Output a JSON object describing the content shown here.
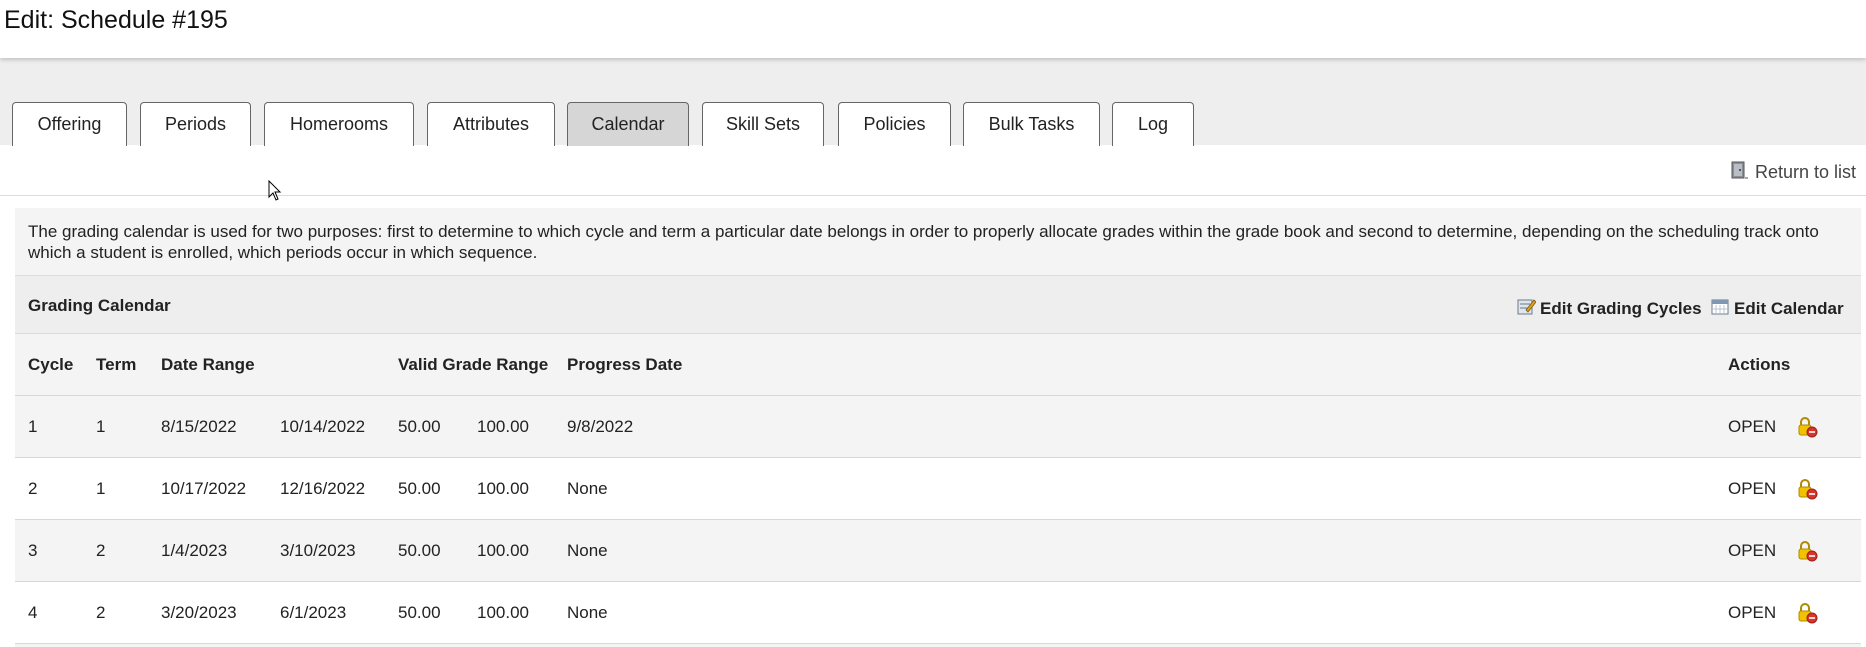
{
  "header": {
    "title": "Edit: Schedule #195"
  },
  "tabs": [
    {
      "label": "Offering",
      "active": false
    },
    {
      "label": "Periods",
      "active": false
    },
    {
      "label": "Homerooms",
      "active": false
    },
    {
      "label": "Attributes",
      "active": false
    },
    {
      "label": "Calendar",
      "active": true
    },
    {
      "label": "Skill Sets",
      "active": false
    },
    {
      "label": "Policies",
      "active": false
    },
    {
      "label": "Bulk Tasks",
      "active": false
    },
    {
      "label": "Log",
      "active": false
    }
  ],
  "return_link": {
    "label": "Return to list",
    "icon": "door-icon"
  },
  "description": "The grading calendar is used for two purposes: first to determine to which cycle and term a particular date belongs in order to properly allocate grades within the grade book and second to determine, depending on the scheduling track onto which a student is enrolled, which periods occur in which sequence.",
  "section": {
    "title": "Grading Calendar",
    "edit_cycles_label": "Edit Grading Cycles",
    "edit_calendar_label": "Edit Calendar"
  },
  "table": {
    "columns": {
      "cycle": "Cycle",
      "term": "Term",
      "date_range": "Date Range",
      "valid_grade_range": "Valid Grade Range",
      "progress_date": "Progress Date",
      "actions": "Actions"
    },
    "rows": [
      {
        "cycle": "1",
        "term": "1",
        "start": "8/15/2022",
        "end": "10/14/2022",
        "grade_min": "50.00",
        "grade_max": "100.00",
        "progress": "9/8/2022",
        "status": "OPEN"
      },
      {
        "cycle": "2",
        "term": "1",
        "start": "10/17/2022",
        "end": "12/16/2022",
        "grade_min": "50.00",
        "grade_max": "100.00",
        "progress": "None",
        "status": "OPEN"
      },
      {
        "cycle": "3",
        "term": "2",
        "start": "1/4/2023",
        "end": "3/10/2023",
        "grade_min": "50.00",
        "grade_max": "100.00",
        "progress": "None",
        "status": "OPEN"
      },
      {
        "cycle": "4",
        "term": "2",
        "start": "3/20/2023",
        "end": "6/1/2023",
        "grade_min": "50.00",
        "grade_max": "100.00",
        "progress": "None",
        "status": "OPEN"
      }
    ]
  },
  "colors": {
    "active_tab": "#d6d6d6",
    "panel_bg": "#f4f4f4",
    "lock_icon": "#e6b800",
    "lock_badge": "#d9342b"
  }
}
